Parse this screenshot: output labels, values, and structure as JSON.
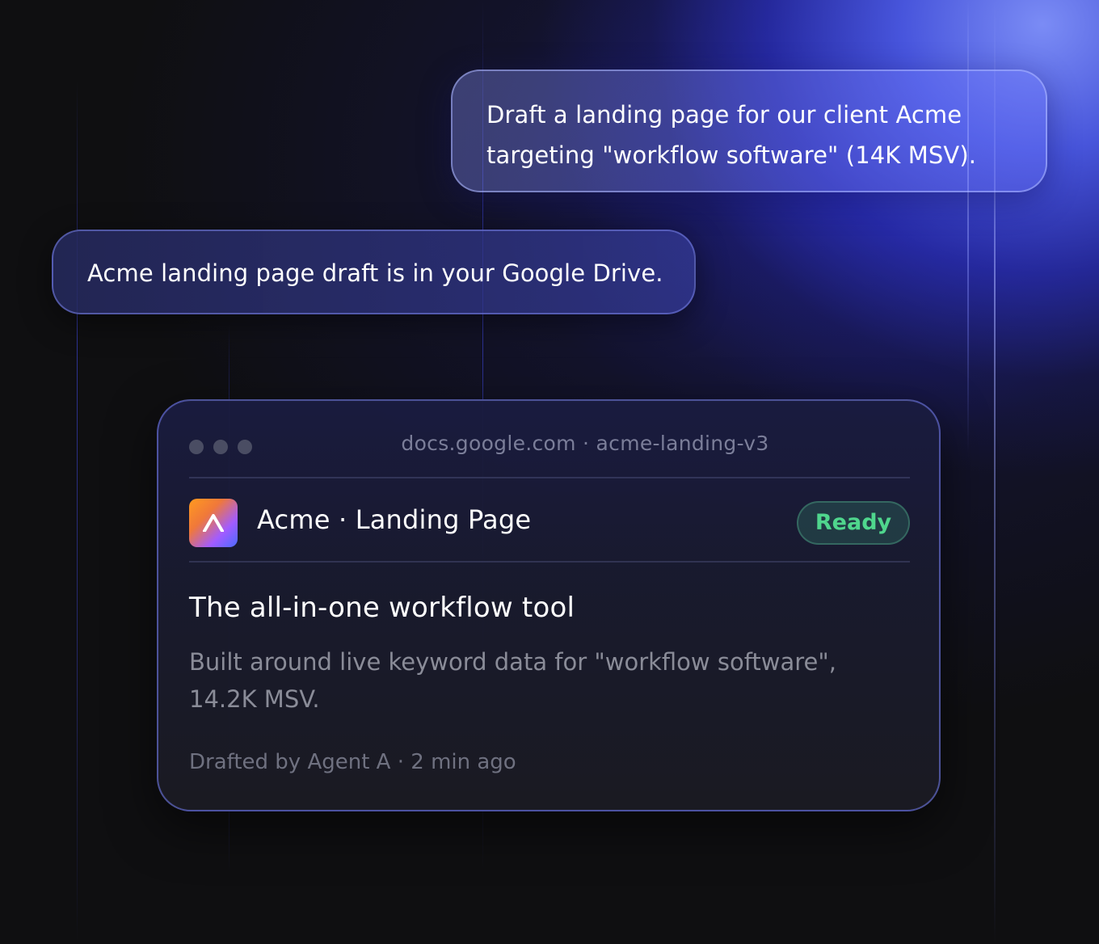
{
  "chat": {
    "user_message": "Draft a landing page for our client Acme targeting \"workflow software\" (14K MSV).",
    "agent_message": "Acme landing page draft is in your Google Drive."
  },
  "doc_card": {
    "url": "docs.google.com · acme-landing-v3",
    "logo_glyph": "Λ",
    "title": "Acme · Landing Page",
    "status": "Ready",
    "headline": "The all-in-one workflow tool",
    "description": "Built around live keyword data for \"workflow software\", 14.2K MSV.",
    "meta": "Drafted by Agent A · 2 min ago"
  },
  "colors": {
    "accent_glow": "#7f92ff",
    "status_ready": "#4fd68d"
  }
}
